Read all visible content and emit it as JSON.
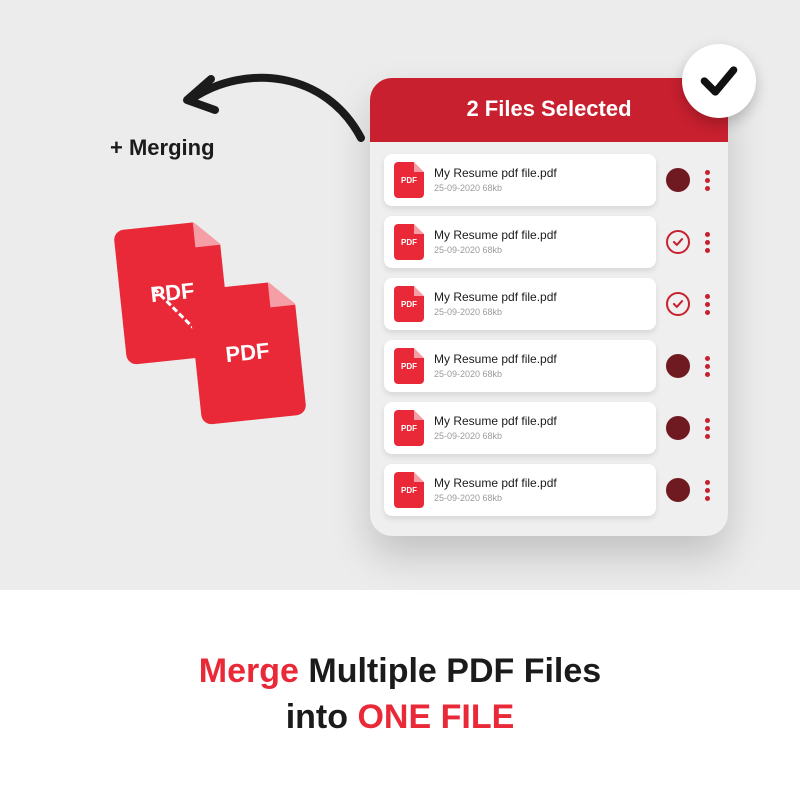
{
  "merging_label": "+ Merging",
  "pdf_illustration": {
    "label": "PDF"
  },
  "panel": {
    "header": "2 Files Selected",
    "files": [
      {
        "name": "My Resume pdf file.pdf",
        "date": "25-09-2020",
        "size": "68kb",
        "selected": "filled"
      },
      {
        "name": "My Resume pdf file.pdf",
        "date": "25-09-2020",
        "size": "68kb",
        "selected": "checked"
      },
      {
        "name": "My Resume pdf file.pdf",
        "date": "25-09-2020",
        "size": "68kb",
        "selected": "checked"
      },
      {
        "name": "My Resume pdf file.pdf",
        "date": "25-09-2020",
        "size": "68kb",
        "selected": "filled"
      },
      {
        "name": "My Resume pdf file.pdf",
        "date": "25-09-2020",
        "size": "68kb",
        "selected": "filled"
      },
      {
        "name": "My Resume pdf file.pdf",
        "date": "25-09-2020",
        "size": "68kb",
        "selected": "filled"
      }
    ],
    "icon_label": "PDF"
  },
  "tagline": {
    "w1": "Merge",
    "w2": "Multiple PDF Files",
    "w3": "into",
    "w4": "ONE FILE"
  }
}
